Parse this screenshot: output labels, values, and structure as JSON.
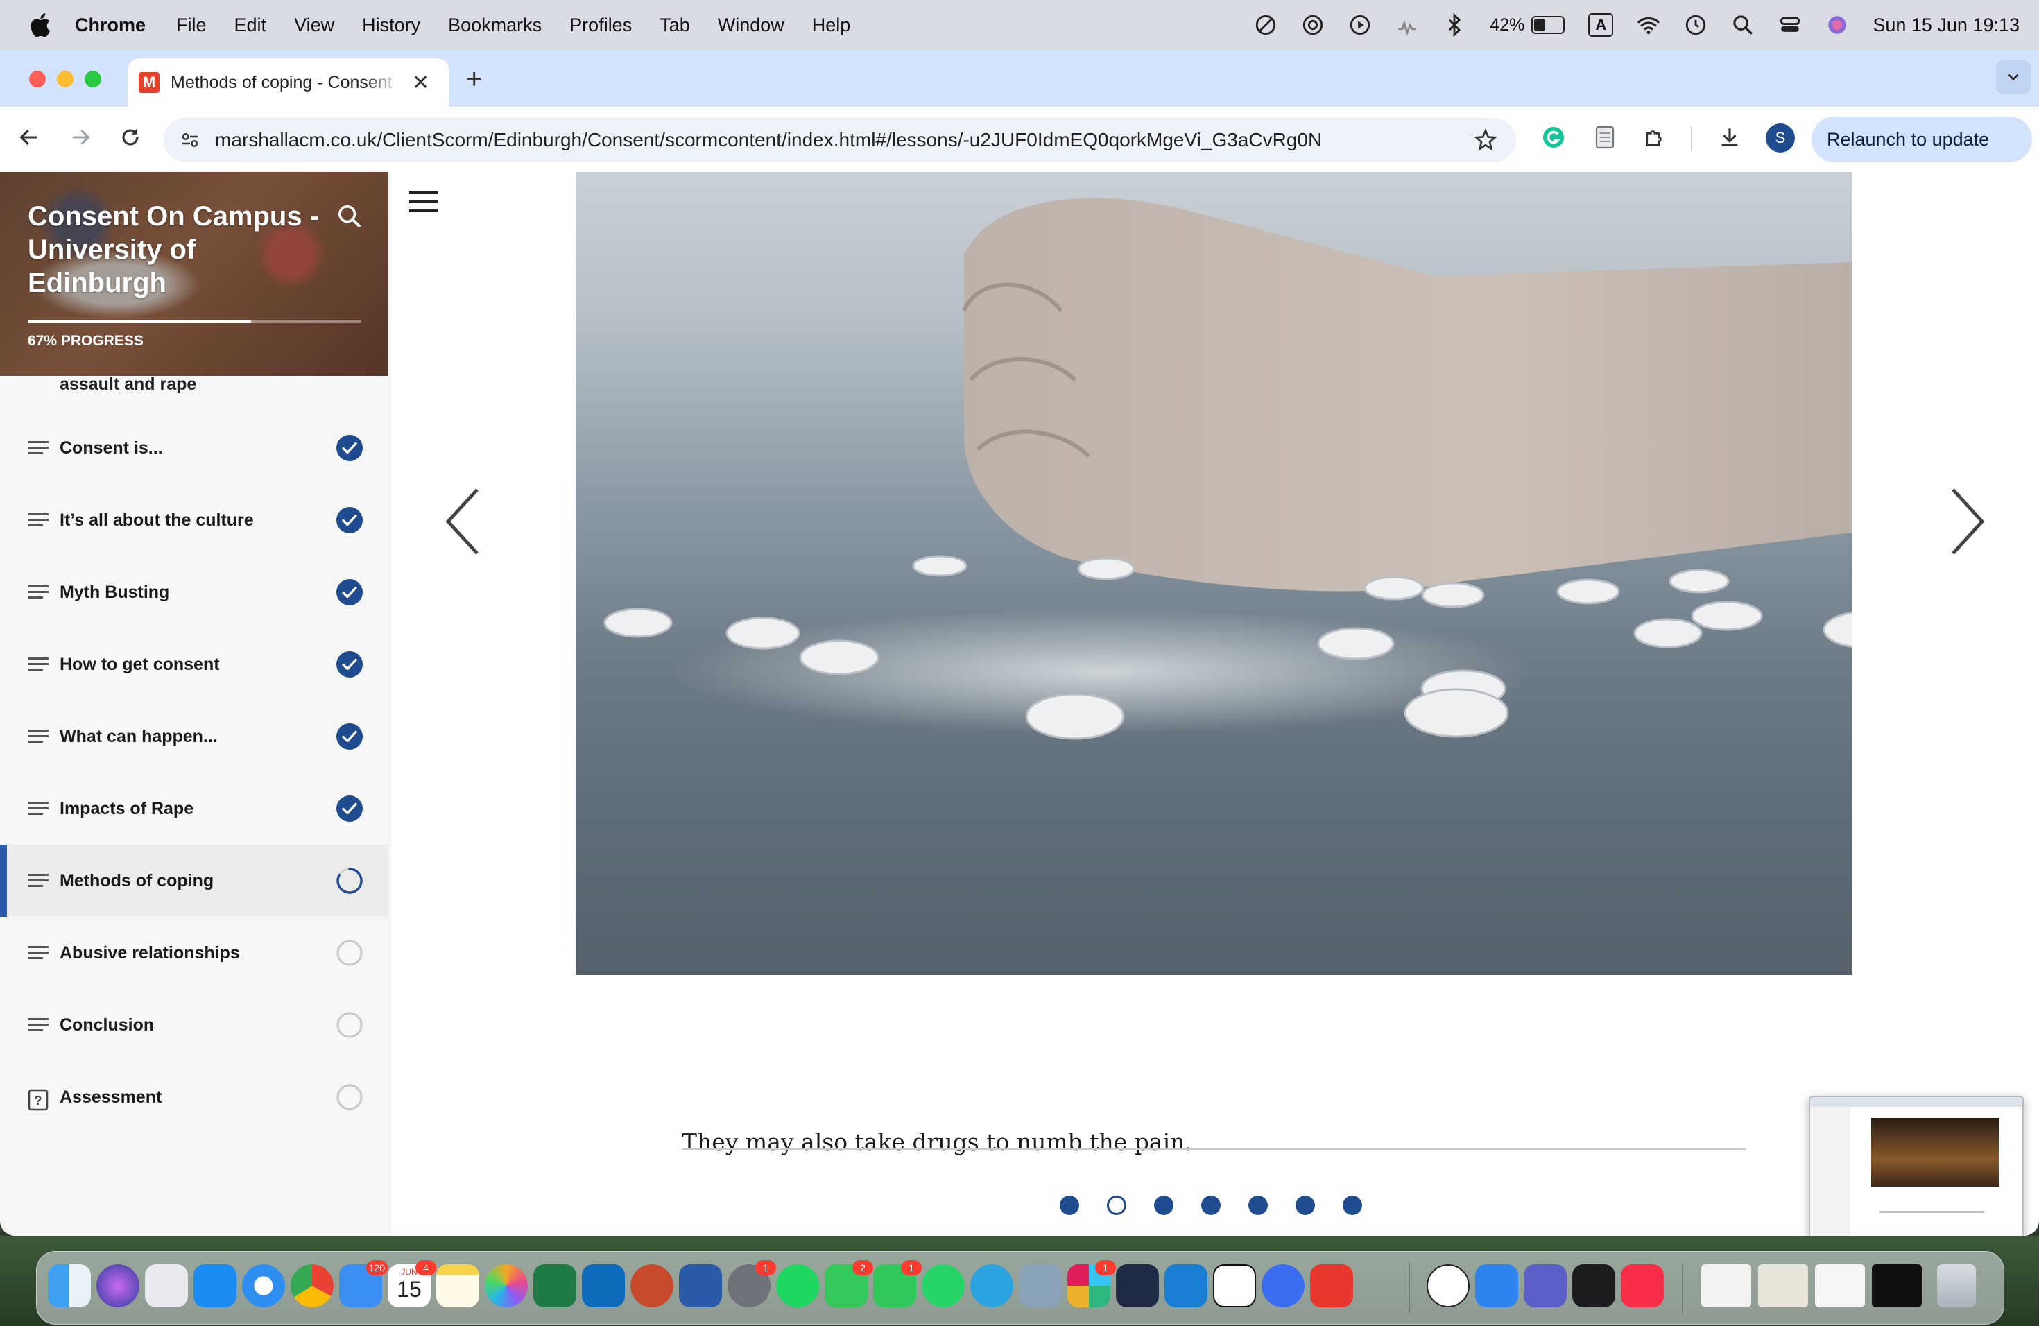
{
  "menubar": {
    "app": "Chrome",
    "items": [
      "File",
      "Edit",
      "View",
      "History",
      "Bookmarks",
      "Profiles",
      "Tab",
      "Window",
      "Help"
    ],
    "battery": "42%",
    "input_indicator": "A",
    "datetime": "Sun 15 Jun  19:13"
  },
  "browser": {
    "tab_title": "Methods of coping - Consent",
    "favicon_letter": "M",
    "url": "marshallacm.co.uk/ClientScorm/Edinburgh/Consent/scormcontent/index.html#/lessons/-u2JUF0IdmEQ0qorkMgeVi_G3aCvRg0N",
    "profile_initial": "S",
    "relaunch_label": "Relaunch to update"
  },
  "course": {
    "title": "Consent On Campus - University of Edinburgh",
    "progress_percent": 67,
    "progress_label": "67% PROGRESS",
    "partial_lesson": "assault and rape",
    "lessons": [
      {
        "label": "Consent is...",
        "status": "complete",
        "icon": "lines-icon"
      },
      {
        "label": "It’s all about the culture",
        "status": "complete",
        "icon": "lines-icon"
      },
      {
        "label": "Myth Busting",
        "status": "complete",
        "icon": "lines-icon"
      },
      {
        "label": "How to get consent",
        "status": "complete",
        "icon": "lines-icon"
      },
      {
        "label": "What can happen...",
        "status": "complete",
        "icon": "lines-icon"
      },
      {
        "label": "Impacts of Rape",
        "status": "complete",
        "icon": "lines-icon"
      },
      {
        "label": "Methods of coping",
        "status": "in-progress",
        "icon": "lines-icon"
      },
      {
        "label": "Abusive relationships",
        "status": "not-started",
        "icon": "lines-icon"
      },
      {
        "label": "Conclusion",
        "status": "not-started",
        "icon": "lines-icon"
      },
      {
        "label": "Assessment",
        "status": "not-started",
        "icon": "question-icon"
      }
    ]
  },
  "slide": {
    "caption": "They may also take drugs to numb the pain.",
    "total_slides": 7,
    "current_slide": 2
  },
  "dock": {
    "badges": {
      "mail": "120",
      "calendar": "4",
      "settings": "1",
      "messages": "2",
      "facetime": "1",
      "slack": "1"
    },
    "calendar_day": "15",
    "calendar_month": "JUN"
  },
  "colors": {
    "accent": "#1f4b8f",
    "active_bar": "#2a5bab",
    "sidebar_bg": "#f7f7f7",
    "tabstrip": "#d3e3fd"
  }
}
